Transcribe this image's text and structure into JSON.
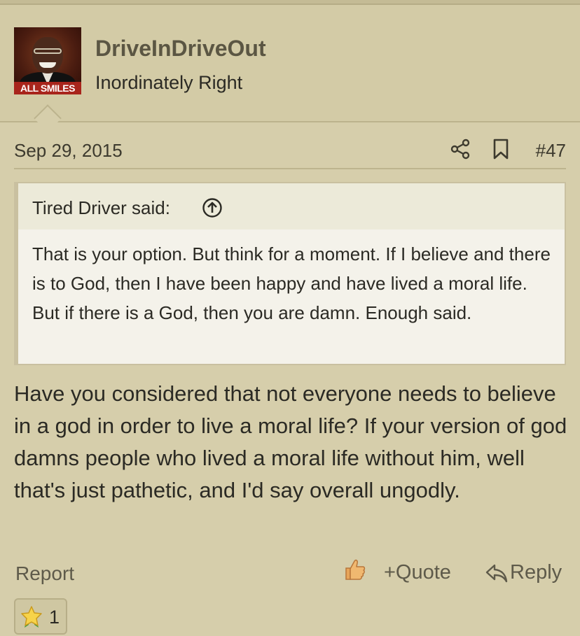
{
  "user": {
    "avatar_caption": "ALL SMILES",
    "name": "DriveInDriveOut",
    "title": "Inordinately Right"
  },
  "post": {
    "date": "Sep 29, 2015",
    "number": "#47",
    "icons": [
      "share-icon",
      "bookmark-icon"
    ]
  },
  "quote": {
    "author_line": "Tired Driver said:",
    "text": "That is your option. But think for a moment. If I believe and there is to God, then I have been happy and have lived a moral life. But if there is a God, then you are damn. Enough said."
  },
  "body": {
    "text": "Have you considered that not everyone needs to believe in a god in order to live a moral life? If your version of god damns people who lived a moral life without him, well that's just pathetic, and I'd say overall ungodly."
  },
  "actions": {
    "report": "Report",
    "quote": "+Quote",
    "reply": "Reply"
  },
  "reactions": {
    "icon": "star-icon",
    "count": "1"
  },
  "colors": {
    "background": "#d6ceab",
    "quote_background": "#f4f2ea",
    "username": "#5b5643",
    "link": "#5e5a4a"
  }
}
